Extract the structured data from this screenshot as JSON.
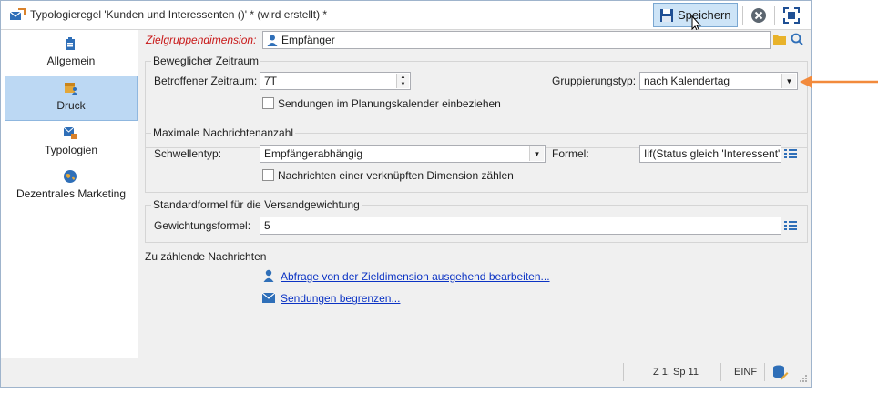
{
  "window": {
    "title": "Typologieregel 'Kunden und Interessenten ()' * (wird erstellt) *"
  },
  "toolbar": {
    "save_label": "Speichern"
  },
  "sidebar": {
    "items": [
      {
        "label": "Allgemein",
        "icon": "typology-general-icon",
        "active": false
      },
      {
        "label": "Druck",
        "icon": "calendar-user-icon",
        "active": true
      },
      {
        "label": "Typologien",
        "icon": "typology-icon",
        "active": false
      },
      {
        "label": "Dezentrales Marketing",
        "icon": "globe-icon",
        "active": false
      }
    ]
  },
  "form": {
    "target_dimension_label": "Zielgruppendimension:",
    "target_dimension_value": "Empfänger",
    "rolling_period": {
      "title": "Beweglicher Zeitraum",
      "period_label": "Betroffener Zeitraum:",
      "period_value": "7T",
      "grouping_label": "Gruppierungstyp:",
      "grouping_value": "nach Kalendertag",
      "planning_checkbox_label": "Sendungen im Planungskalender einbeziehen",
      "planning_checked": false
    },
    "max_messages": {
      "title": "Maximale Nachrichtenanzahl",
      "threshold_label": "Schwellentyp:",
      "threshold_value": "Empfängerabhängig",
      "formula_label": "Formel:",
      "formula_value": "Iif(Status gleich 'Interessent', ...",
      "linked_checkbox_label": "Nachrichten einer verknüpften Dimension zählen",
      "linked_checked": false
    },
    "weighting": {
      "title": "Standardformel für die Versandgewichtung",
      "formula_label": "Gewichtungsformel:",
      "formula_value": "5"
    },
    "messages_to_count": {
      "title": "Zu zählende Nachrichten",
      "edit_query_link": "Abfrage von der Zieldimension ausgehend bearbeiten...",
      "limit_deliveries_link": "Sendungen begrenzen..."
    }
  },
  "statusbar": {
    "position": "Z 1, Sp 11",
    "mode": "EINF"
  },
  "colors": {
    "required_label": "#c81818",
    "link": "#0b33c4",
    "active_sidebar": "#bcd8f3",
    "annotation_arrow": "#f28a3c"
  }
}
